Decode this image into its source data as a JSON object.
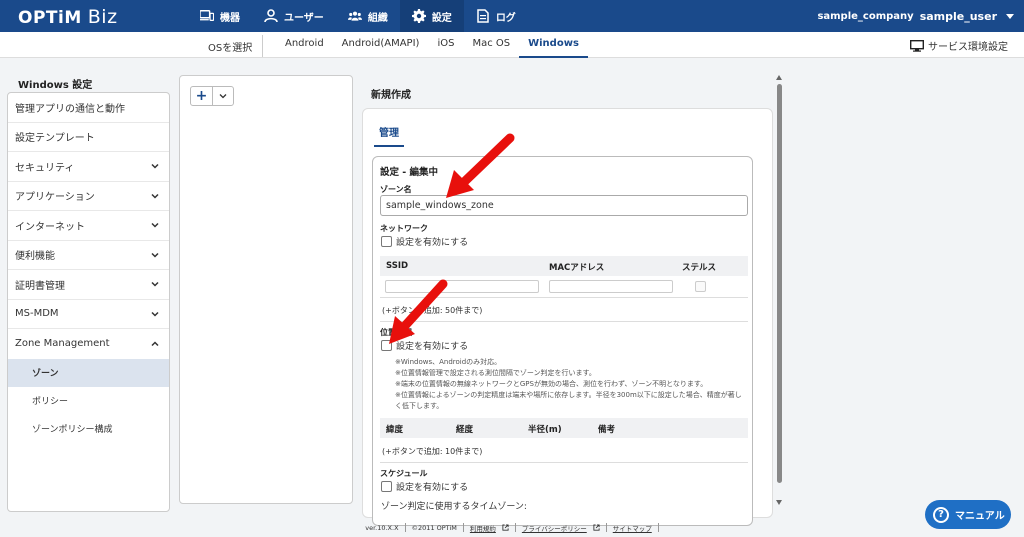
{
  "brand": {
    "logo": "OPTiM",
    "product": "Biz"
  },
  "topnav": [
    {
      "label": "機器",
      "icon": "devices-icon"
    },
    {
      "label": "ユーザー",
      "icon": "user-icon"
    },
    {
      "label": "組織",
      "icon": "group-icon"
    },
    {
      "label": "設定",
      "icon": "gear-icon",
      "active": true
    },
    {
      "label": "ログ",
      "icon": "log-icon"
    }
  ],
  "account": {
    "company": "sample_company",
    "user": "sample_user"
  },
  "subbar": {
    "os_select_label": "OSを選択",
    "os_tabs": [
      "Android",
      "Android(AMAPI)",
      "iOS",
      "Mac OS",
      "Windows"
    ],
    "active_os": "Windows",
    "service_setting": "サービス環境設定"
  },
  "sidebar": {
    "title": "Windows 設定",
    "items": [
      {
        "label": "管理アプリの通信と動作"
      },
      {
        "label": "設定テンプレート"
      },
      {
        "label": "セキュリティ"
      },
      {
        "label": "アプリケーション"
      },
      {
        "label": "インターネット"
      },
      {
        "label": "便利機能"
      },
      {
        "label": "証明書管理"
      },
      {
        "label": "MS-MDM"
      },
      {
        "label": "Zone Management"
      }
    ],
    "sub_items": [
      "ゾーン",
      "ポリシー",
      "ゾーンポリシー構成"
    ],
    "active_sub": "ゾーン"
  },
  "middle": {
    "add_label": "+"
  },
  "form": {
    "title": "新規作成",
    "tab": "管理",
    "box_title": "設定 - 編集中",
    "zone_name_label": "ゾーン名",
    "zone_name_value": "sample_windows_zone",
    "network_label": "ネットワーク",
    "enable_label": "設定を有効にする",
    "network_columns": [
      "SSID",
      "MACアドレス",
      "ステルス"
    ],
    "network_note": "(+ボタンで追加: 50件まで)",
    "location_label": "位置情報",
    "location_notes": [
      "※Windows、Androidのみ対応。",
      "※位置情報管理で設定される測位間隔でゾーン判定を行います。",
      "※端末の位置情報の無線ネットワークとGPSが無効の場合、測位を行わず、ゾーン不明となります。",
      "※位置情報によるゾーンの判定精度は端末や場所に依存します。半径を300m以下に設定した場合、精度が著しく低下します。"
    ],
    "location_columns": [
      "緯度",
      "経度",
      "半径(m)",
      "備考"
    ],
    "location_note": "(+ボタンで追加: 10件まで)",
    "schedule_label": "スケジュール",
    "timezone_label": "ゾーン判定に使用するタイムゾーン:"
  },
  "footer": {
    "version": "ver.10.X.X",
    "copyright": "©2011 OPTiM",
    "terms": "利用規約",
    "privacy": "プライバシーポリシー",
    "sitemap": "サイトマップ"
  },
  "manual_button": "マニュアル",
  "colors": {
    "brand": "#1a4a8b",
    "accent": "#1f6fc5",
    "annotation_arrow": "#e8100c"
  }
}
